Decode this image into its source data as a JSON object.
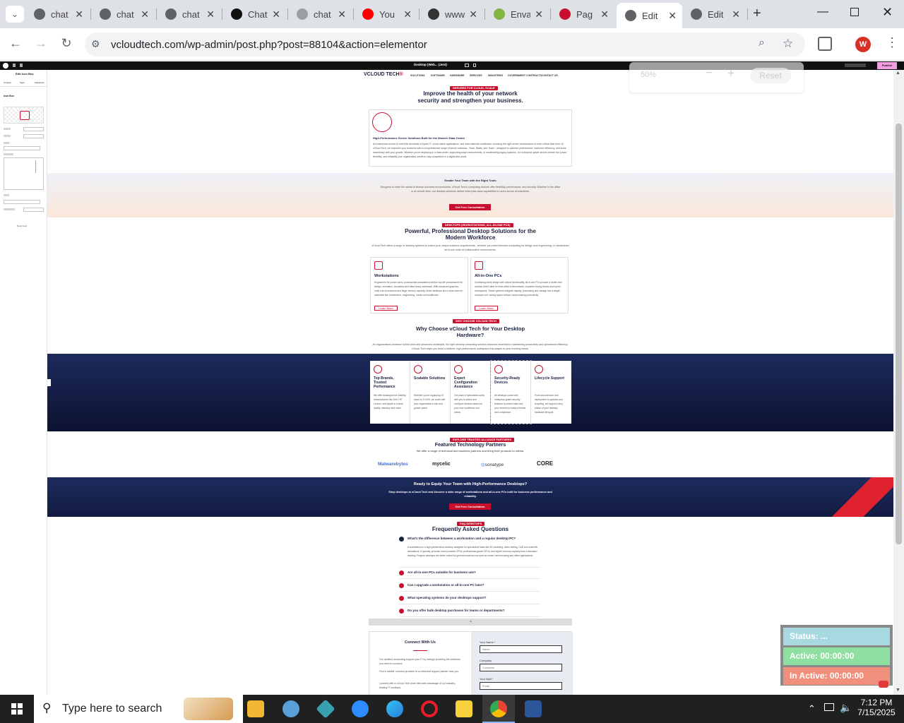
{
  "browser": {
    "tabs": [
      {
        "title": "chat",
        "color": "#5f6368"
      },
      {
        "title": "chat",
        "color": "#5f6368"
      },
      {
        "title": "chat",
        "color": "#5f6368"
      },
      {
        "title": "Chat",
        "color": "#111111"
      },
      {
        "title": "chat",
        "color": "#9aa0a6"
      },
      {
        "title": "You",
        "color": "#ff0000"
      },
      {
        "title": "www",
        "color": "#333333"
      },
      {
        "title": "Enva",
        "color": "#82b541"
      },
      {
        "title": "Pag",
        "color": "#c8102e"
      },
      {
        "title": "Edit",
        "color": "#5f6368"
      },
      {
        "title": "Edit",
        "color": "#5f6368"
      }
    ],
    "active_tab_index": 9,
    "url": "vcloudtech.com/wp-admin/post.php?post=88104&action=elementor",
    "profile_initial": "W"
  },
  "elementor": {
    "device_label": "Desktop (Web... (Jest)",
    "publish_label": "Publish",
    "panel_title": "Edit Icon Box",
    "panel_tabs": [
      "Content",
      "Style",
      "Advanced"
    ],
    "panel_section": "Icon Box",
    "need_help": "Need Help"
  },
  "zoom": {
    "level": "50%",
    "minus": "−",
    "plus": "+",
    "reset": "Reset"
  },
  "page": {
    "logo": "VCLOUD TECH",
    "nav": [
      "SOLUTIONS",
      "SOFTWARE",
      "HARDWARE",
      "SERVICES",
      "INDUSTRIES",
      "GOVERNMENT CONTRACTS",
      "CONTACT US"
    ],
    "hero": {
      "pill": "SERVERS FOR CLOUD, SCALE",
      "heading_line1": "Improve the health of your network",
      "heading_line2": "security and strengthen your business.",
      "card_title": "High-Performance Server Solutions Built for the Modern Data Center",
      "card_text": "As enterprises evolve to meet the demands of hybrid IT, cloud-native applications, and data-intensive workloads, choosing the right server infrastructure is more critical than ever. At vCloud Tech, we empower your business with a comprehensive range of server solutions - Rack, Blade, and Tower - designed to optimize performance, maximize efficiency, and scale seamlessly with your growth. Whether you're deploying in a data center, supporting edge environments, or modernizing legacy systems, our enterprise-grade servers deliver the power, flexibility, and reliability your organization needs to stay competitive in a digital-first world."
    },
    "band": {
      "title": "Enable Your Team with the Right Tools",
      "text": "Designed to meet the needs of diverse business environments, vCloud Tech's computing devices offer flexibility, performance, and security. Whether in the office or at remote sites, our desktop solutions deliver enterprise-class capabilities to users across all industries.",
      "button": "Get Free Consultation"
    },
    "desktops": {
      "pill": "DESKTOPS (WORKSTATIONS, ALL-IN-ONE PCS)",
      "heading_line1": "Powerful, Professional Desktop Solutions for the",
      "heading_line2": "Modern Workforce",
      "text": "vCloud Tech offers a range of desktop systems to match your unique business requirements - whether you need intensive computing for design and engineering, or streamlined all-in-one units for collaborative environments.",
      "cards": [
        {
          "title": "Workstations",
          "text": "Engineered for power users, professional workstations deliver top-tier performance for design, animation, simulation and data-heavy workloads. With advanced graphics, multi-core processors and large memory capacity, these desktops are a must-have for industries like architecture, engineering, media and healthcare.",
          "button": "Learn More"
        },
        {
          "title": "All-in-One PCs",
          "text": "Combining sleek design with robust functionality, all-in-one PCs provide a clutter-free solution that's ideal for front-office environments, customer-facing kiosks and hybrid workspaces. These systems integrate display, processing and storage into a single compact unit, saving space without compromising productivity.",
          "button": "Learn More"
        }
      ]
    },
    "why": {
      "pill": "WHY CHOOSE VCLOUD TECH",
      "heading_line1": "Why Choose vCloud Tech for Your Desktop",
      "heading_line2": "Hardware?",
      "text": "As organizations embrace hybrid work and advanced workloads, the right desktop computing solution becomes essential to maintaining productivity and operational efficiency. vCloud Tech helps you build a resilient, high-performance workspace that adapts to your evolving needs.",
      "items": [
        {
          "title": "Top Brands, Trusted Performance",
          "text": "We offer desktops from leading manufacturers like Dell, HP, Lenovo, and Apple to ensure quality, warranty and value."
        },
        {
          "title": "Scalable Solutions",
          "text": "Whether you're equipping 10 users or 10,000, we scale with your organization's size and growth plans."
        },
        {
          "title": "Expert Configuration Assistance",
          "text": "Our team of specialists works with you to select and configure devices based on your user workflows and needs."
        },
        {
          "title": "Security-Ready Devices",
          "text": "All desktops come with enterprise-grade security features to protect data and your devices to today's threats and compliance."
        },
        {
          "title": "Lifecycle Support",
          "text": "From procurement and deployment to updates and recycling, we support every phase of your desktop hardware lifecycle."
        }
      ]
    },
    "partners": {
      "pill": "EXPLORE TRUSTED ALLIANCE PARTNERS",
      "heading": "Featured Technology Partners",
      "subtitle": "We offer a range of technical and business partners and bring their products to clients.",
      "logos": [
        "Malwarebytes",
        "mycelic",
        "sonatype",
        "CORE"
      ]
    },
    "cta": {
      "title": "Ready to Equip Your Team with High-Performance Desktops?",
      "text": "Shop desktops at vCloud Tech and discover a wide range of workstations and all-in-one PCs built for business performance and reliability.",
      "button": "Get Free Consultation"
    },
    "faq": {
      "pill": "FAQ DESKTOPS",
      "heading": "Frequently Asked Questions",
      "items": [
        {
          "q": "What's the difference between a workstation and a regular desktop PC?",
          "a": "A workstation is a high-performance desktop designed for specialized tasks like 3D modeling, video editing, CAD and scientific simulations. It typically provides more powerful CPUs, professional-grade GPUs, and higher memory capacity than a standard desktop. Regular desktops are better suited for general business use such as email, web browsing and office applications."
        },
        {
          "q": "Are all-in-one PCs suitable for business use?",
          "a": ""
        },
        {
          "q": "Can I upgrade a workstation or all-in-one PC later?",
          "a": ""
        },
        {
          "q": "What operating systems do your desktops support?",
          "a": ""
        },
        {
          "q": "Do you offer bulk desktop purchases for teams or departments?",
          "a": ""
        }
      ]
    },
    "contact": {
      "title": "Connect With Us",
      "p1": "Our certified accounting support your IT by lovingly providing the solutions you need to succeed.",
      "p2": "Find a market, connect provides to vs electrical support partner near you.",
      "p3": "Connect with a vCloud Tech team lists take advantage of our industry-leading IT solutions.",
      "fields": [
        {
          "label": "Your Name *",
          "placeholder": "Name"
        },
        {
          "label": "Company",
          "placeholder": "Company"
        },
        {
          "label": "Your Mail *",
          "placeholder": "Email"
        }
      ]
    }
  },
  "status_widget": {
    "status": "Status: ...",
    "active": "Active: 00:00:00",
    "inactive": "In Active: 00:00:00",
    "colors": {
      "status": "#a8d8e0",
      "active": "#8fe0a0",
      "inactive": "#f0907c"
    }
  },
  "taskbar": {
    "search_placeholder": "Type here to search",
    "time": "7:12 PM",
    "date": "7/15/2025"
  }
}
